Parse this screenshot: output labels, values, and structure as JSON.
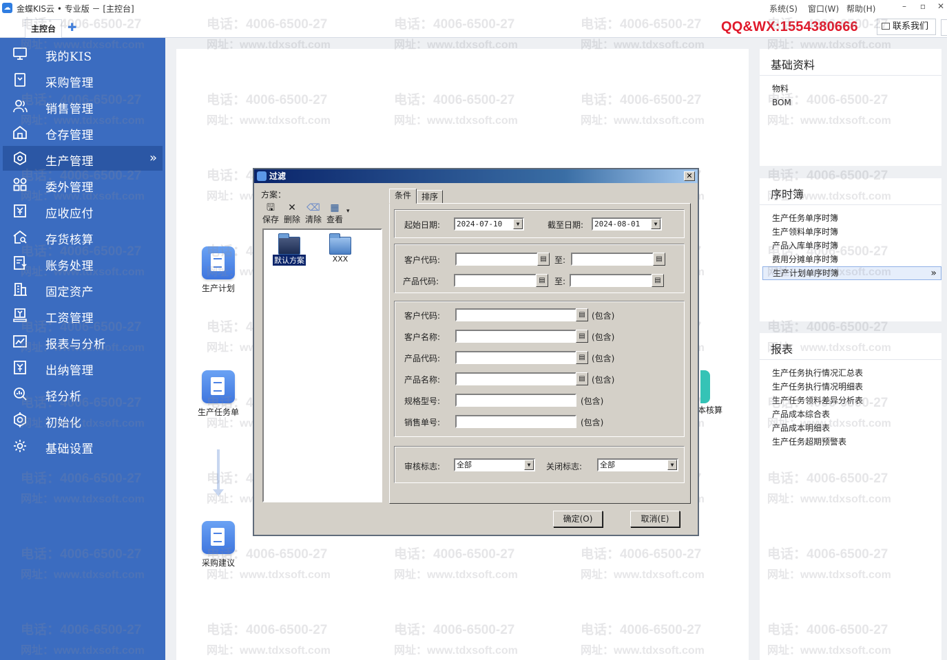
{
  "titlebar": {
    "title": "金蝶KIS云 • 专业版 － [主控台]",
    "menus": [
      "系统(S)",
      "窗口(W)",
      "帮助(H)"
    ],
    "buttons": [
      "–",
      "▫",
      "✕"
    ]
  },
  "tabs": {
    "main_tab": "主控台",
    "add": "✚",
    "promo": "QQ&WX:1554380666",
    "contact": "联系我们"
  },
  "sidebar": {
    "items": [
      {
        "label": "我的KIS",
        "icon": "monitor-icon"
      },
      {
        "label": "采购管理",
        "icon": "purchase-icon"
      },
      {
        "label": "销售管理",
        "icon": "users-icon"
      },
      {
        "label": "仓存管理",
        "icon": "warehouse-icon"
      },
      {
        "label": "生产管理",
        "icon": "gear-hex-icon",
        "active": true
      },
      {
        "label": "委外管理",
        "icon": "grid-icon"
      },
      {
        "label": "应收应付",
        "icon": "yen-icon"
      },
      {
        "label": "存货核算",
        "icon": "inventory-icon"
      },
      {
        "label": "账务处理",
        "icon": "ledger-icon"
      },
      {
        "label": "固定资产",
        "icon": "building-icon"
      },
      {
        "label": "工资管理",
        "icon": "salary-icon"
      },
      {
        "label": "报表与分析",
        "icon": "chart-icon"
      },
      {
        "label": "出纳管理",
        "icon": "cashier-icon"
      },
      {
        "label": "轻分析",
        "icon": "magnifier-icon"
      },
      {
        "label": "初始化",
        "icon": "target-icon"
      },
      {
        "label": "基础设置",
        "icon": "settings-icon"
      }
    ],
    "active_arrow": "»"
  },
  "main": {
    "nodes": [
      {
        "label": "生产计划"
      },
      {
        "label": "生产任务单"
      },
      {
        "label": "采购建议"
      }
    ],
    "partial_label": "本核算"
  },
  "right": {
    "basic": {
      "title": "基础资料",
      "items": [
        "物料",
        "BOM"
      ]
    },
    "timeline": {
      "title": "序时簿",
      "items": [
        "生产任务单序时簿",
        "生产领料单序时簿",
        "产品入库单序时簿",
        "费用分摊单序时簿",
        "生产计划单序时簿"
      ],
      "selected_index": 4,
      "arrow": "»"
    },
    "reports": {
      "title": "报表",
      "items": [
        "生产任务执行情况汇总表",
        "生产任务执行情况明细表",
        "生产任务领料差异分析表",
        "产品成本综合表",
        "产品成本明细表",
        "生产任务超期预警表"
      ]
    }
  },
  "dialog": {
    "title": "过滤",
    "close": "✕",
    "scheme_label": "方案：",
    "toolbar": [
      {
        "label": "保存",
        "icon": "save-icon",
        "glyph": "🖫"
      },
      {
        "label": "删除",
        "icon": "delete-icon",
        "glyph": "✕"
      },
      {
        "label": "清除",
        "icon": "eraser-icon",
        "glyph": "⌫"
      },
      {
        "label": "查看",
        "icon": "view-icon",
        "glyph": "▦"
      }
    ],
    "toolbar_dropdown": "▾",
    "schemes": [
      {
        "label": "默认方案",
        "selected": true
      },
      {
        "label": "XXX",
        "selected": false
      }
    ],
    "tabs": [
      "条件",
      "排序"
    ],
    "start_date_label": "起始日期:",
    "start_date": "2024-07-10",
    "end_date_label": "截至日期:",
    "end_date": "2024-08-01",
    "customer_code_label": "客户代码:",
    "product_code_label": "产品代码:",
    "to_label": "至:",
    "filters": [
      {
        "label": "客户代码:",
        "lookup": true,
        "suffix": "(包含)"
      },
      {
        "label": "客户名称:",
        "lookup": true,
        "suffix": "(包含)"
      },
      {
        "label": "产品代码:",
        "lookup": true,
        "suffix": "(包含)"
      },
      {
        "label": "产品名称:",
        "lookup": true,
        "suffix": "(包含)"
      },
      {
        "label": "规格型号:",
        "lookup": false,
        "suffix": "(包含)"
      },
      {
        "label": "销售单号:",
        "lookup": false,
        "suffix": "(包含)"
      }
    ],
    "audit_label": "审核标志:",
    "audit_value": "全部",
    "close_flag_label": "关闭标志:",
    "close_flag_value": "全部",
    "ok_label": "确定(O)",
    "cancel_label": "取消(E)",
    "lookup_glyph": "▤",
    "dd_glyph": "▼"
  },
  "watermark": {
    "phone": "电话：4006-6500-27",
    "url": "网址：www.tdxsoft.com"
  }
}
